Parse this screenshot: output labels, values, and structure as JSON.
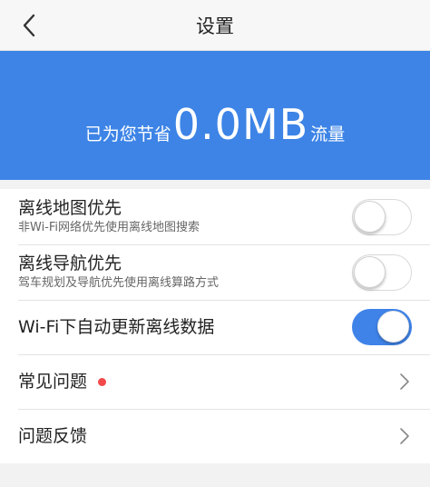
{
  "header": {
    "title": "设置",
    "back_icon": "chevron-left-icon"
  },
  "banner": {
    "prefix": "已为您节省",
    "amount": "0.0MB",
    "suffix": "流量",
    "background": "#3d84e6"
  },
  "settings": [
    {
      "label": "离线地图优先",
      "sub": "非Wi-Fi网络优先使用离线地图搜索",
      "type": "toggle",
      "on": false
    },
    {
      "label": "离线导航优先",
      "sub": "驾车规划及导航优先使用离线算路方式",
      "type": "toggle",
      "on": false
    },
    {
      "label": "Wi-Fi下自动更新离线数据",
      "type": "toggle",
      "on": true
    },
    {
      "label": "常见问题",
      "type": "link",
      "badge": "red-dot"
    },
    {
      "label": "问题反馈",
      "type": "link"
    }
  ],
  "colors": {
    "accent": "#3f83e8",
    "badge": "#f24a4a"
  }
}
